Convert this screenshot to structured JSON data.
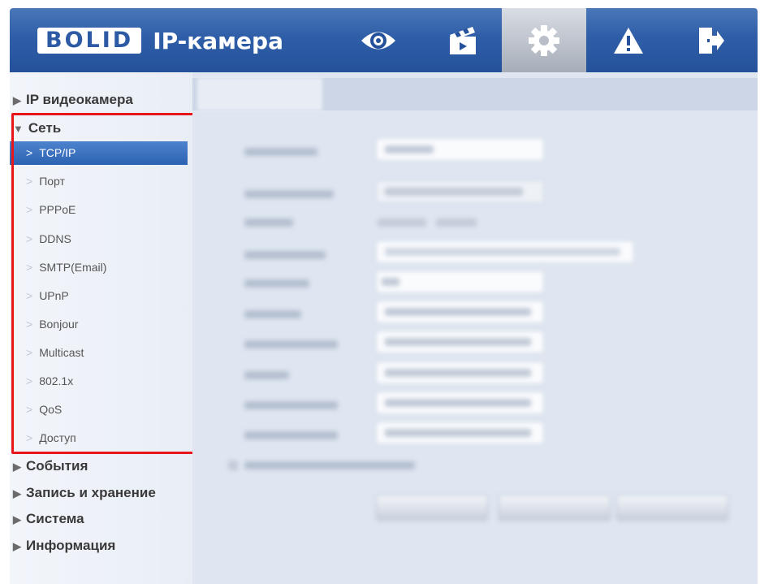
{
  "header": {
    "logo": "BOLID",
    "title": "IP-камера",
    "icons": [
      "eye-icon",
      "clapperboard-icon",
      "gear-icon",
      "warning-icon",
      "logout-icon"
    ],
    "active_icon": "gear-icon"
  },
  "sidebar": {
    "sections": [
      {
        "label": "IP видеокамера",
        "expanded": false
      },
      {
        "label": "Сеть",
        "expanded": true
      },
      {
        "label": "События",
        "expanded": false
      },
      {
        "label": "Запись и хранение",
        "expanded": false
      },
      {
        "label": "Система",
        "expanded": false
      },
      {
        "label": "Информация",
        "expanded": false
      }
    ],
    "network_items": [
      {
        "label": "TCP/IP",
        "active": true
      },
      {
        "label": "Порт"
      },
      {
        "label": "PPPoE"
      },
      {
        "label": "DDNS"
      },
      {
        "label": "SMTP(Email)"
      },
      {
        "label": "UPnP"
      },
      {
        "label": "Bonjour"
      },
      {
        "label": "Multicast"
      },
      {
        "label": "802.1x"
      },
      {
        "label": "QoS"
      },
      {
        "label": "Доступ"
      }
    ],
    "glyphs": {
      "collapsed": "▶",
      "expanded": "▼",
      "chevron": ">"
    }
  },
  "colors": {
    "header": "#2f5ea8",
    "active_item": "#3a70bf",
    "highlight_box": "#e8151a"
  }
}
